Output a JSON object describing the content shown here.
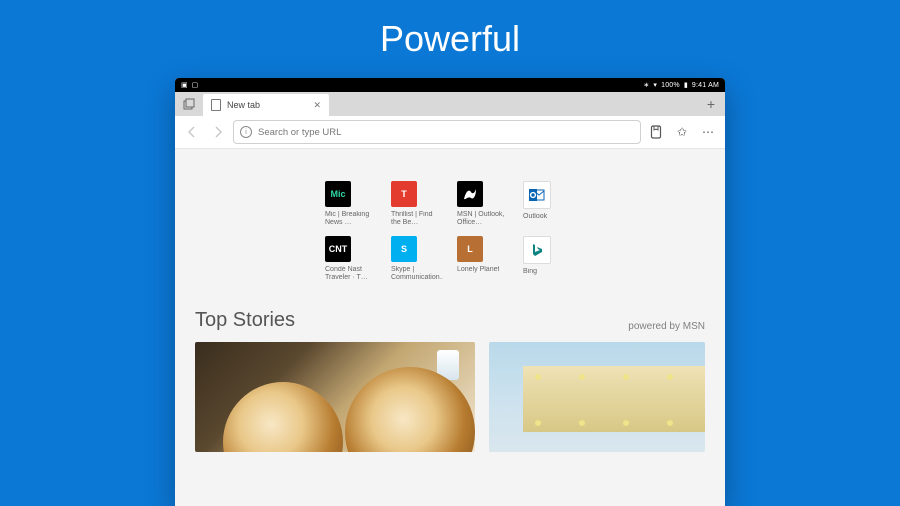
{
  "hero": "Powerful",
  "status": {
    "battery": "100%",
    "time": "9:41 AM"
  },
  "tab": {
    "label": "New tab"
  },
  "url": {
    "placeholder": "Search or type URL"
  },
  "tiles": [
    {
      "label": "Mic | Breaking News …",
      "text": "Mic",
      "bg": "#000000",
      "fg": "#2fd9a3"
    },
    {
      "label": "Thrillist | Find the Be…",
      "text": "T",
      "bg": "#e33c2e",
      "fg": "#ffffff"
    },
    {
      "label": "MSN | Outlook, Office…",
      "text": "",
      "bg": "#000000",
      "fg": "#ffffff",
      "icon": "msn"
    },
    {
      "label": "Outlook",
      "text": "",
      "bg": "#ffffff",
      "fg": "#0a64b4",
      "icon": "outlook",
      "border": "#dcdcdc"
    },
    {
      "label": "Condé Nast Traveler · T…",
      "text": "CNT",
      "bg": "#000000",
      "fg": "#ffffff"
    },
    {
      "label": "Skype | Communication…",
      "text": "S",
      "bg": "#00aff0",
      "fg": "#ffffff"
    },
    {
      "label": "Lonely Planet",
      "text": "L",
      "bg": "#b76f33",
      "fg": "#ffffff"
    },
    {
      "label": "Bing",
      "text": "",
      "bg": "#ffffff",
      "fg": "#0c8484",
      "icon": "bing",
      "border": "#dcdcdc"
    }
  ],
  "stories": {
    "heading": "Top Stories",
    "byline": "powered by MSN"
  }
}
